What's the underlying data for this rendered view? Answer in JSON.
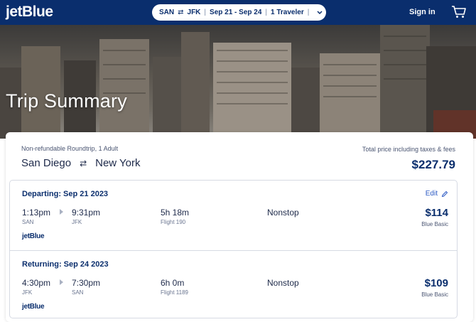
{
  "header": {
    "logo": "jetBlue",
    "search": {
      "origin": "SAN",
      "destination": "JFK",
      "dates": "Sep 21 - Sep 24",
      "travelers": "1 Traveler"
    },
    "signin": "Sign in",
    "colors": {
      "navy": "#0a2e6d",
      "link": "#2b59c3"
    }
  },
  "hero": {
    "title": "Trip Summary"
  },
  "summary": {
    "trip_type": "Non-refundable Roundtrip, 1 Adult",
    "from_city": "San Diego",
    "to_city": "New York",
    "total_label": "Total price including taxes & fees",
    "total_price": "$227.79"
  },
  "departing": {
    "heading": "Departing: Sep 21 2023",
    "edit": "Edit",
    "depart_time": "1:13pm",
    "depart_code": "SAN",
    "arrive_time": "9:31pm",
    "arrive_code": "JFK",
    "duration": "5h 18m",
    "flight": "Flight 190",
    "stops": "Nonstop",
    "price": "$114",
    "fare": "Blue Basic",
    "carrier": "jetBlue"
  },
  "returning": {
    "heading": "Returning: Sep 24 2023",
    "depart_time": "4:30pm",
    "depart_code": "JFK",
    "arrive_time": "7:30pm",
    "arrive_code": "SAN",
    "duration": "6h 0m",
    "flight": "Flight 1189",
    "stops": "Nonstop",
    "price": "$109",
    "fare": "Blue Basic",
    "carrier": "jetBlue"
  }
}
